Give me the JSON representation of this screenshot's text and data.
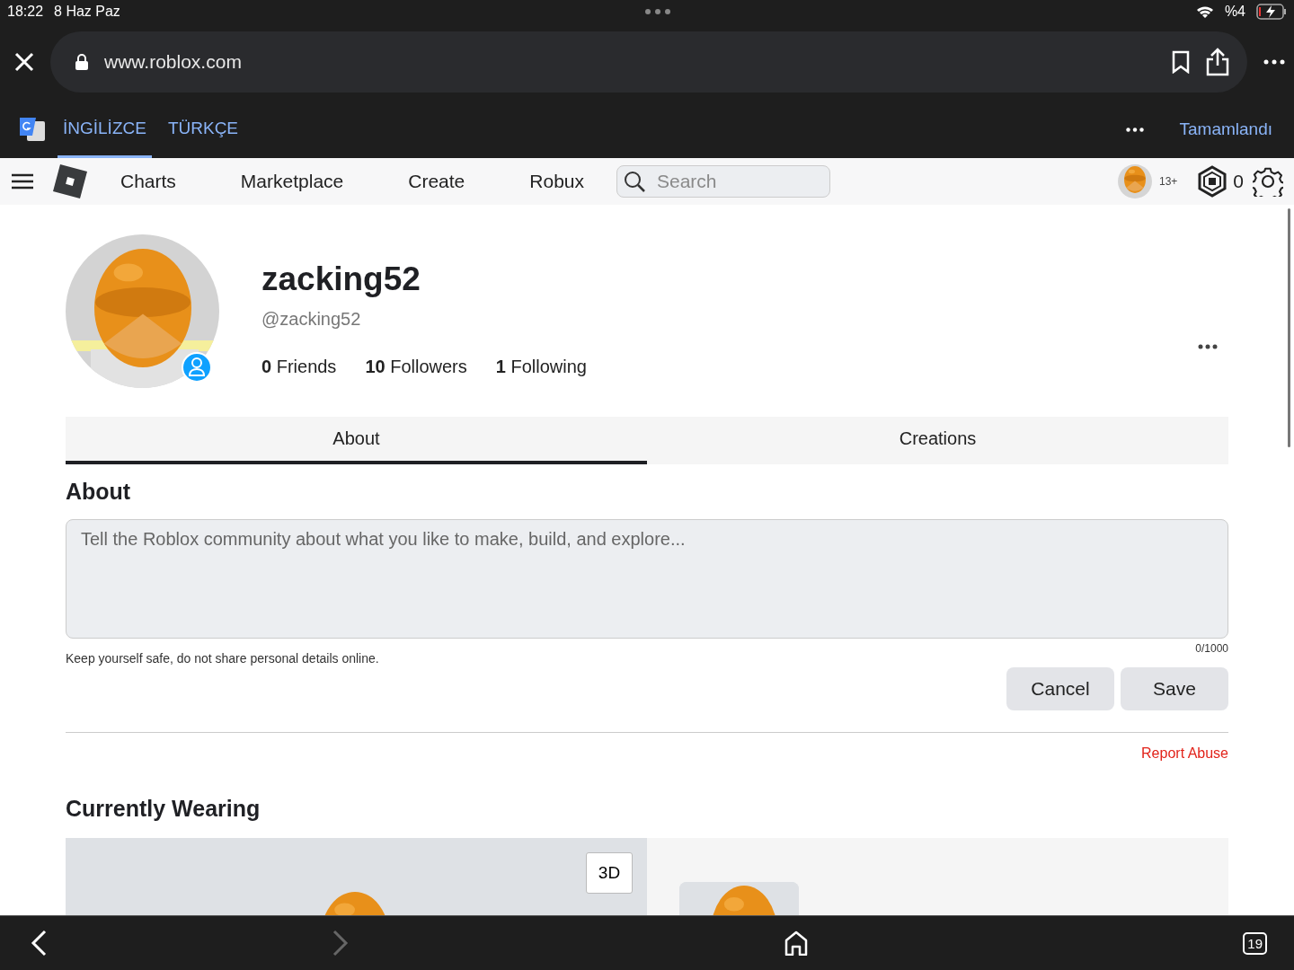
{
  "status_bar": {
    "time": "18:22",
    "date": "8 Haz Paz",
    "battery": "%4"
  },
  "browser": {
    "url": "www.roblox.com"
  },
  "translate_bar": {
    "languages": [
      {
        "label": "İNGİLİZCE",
        "selected": true
      },
      {
        "label": "TÜRKÇE",
        "selected": false
      }
    ],
    "done": "Tamamlandı"
  },
  "nav": {
    "links": [
      "Charts",
      "Marketplace",
      "Create",
      "Robux"
    ],
    "search": {
      "placeholder": "Search"
    },
    "age": "13+",
    "robux": "0"
  },
  "profile": {
    "display_name": "zacking52",
    "username": "@zacking52",
    "stats": [
      "**0** Friends",
      "**10** Followers",
      "**1** Following"
    ]
  },
  "tabs": [
    {
      "label": "About",
      "selected": true
    },
    {
      "label": "Creations",
      "selected": false
    }
  ],
  "about": {
    "heading": "About",
    "placeholder": "Tell the Roblox community about what you like to make, build, and explore...",
    "safety_note": "Keep yourself safe, do not share personal details online.",
    "counter": "0/1000",
    "buttons": [
      "Cancel",
      "Save"
    ],
    "report": "Report Abuse"
  },
  "wearing": {
    "heading": "Currently Wearing",
    "toggle": "3D"
  },
  "bottom_bar": {
    "tabs_count": "19"
  }
}
